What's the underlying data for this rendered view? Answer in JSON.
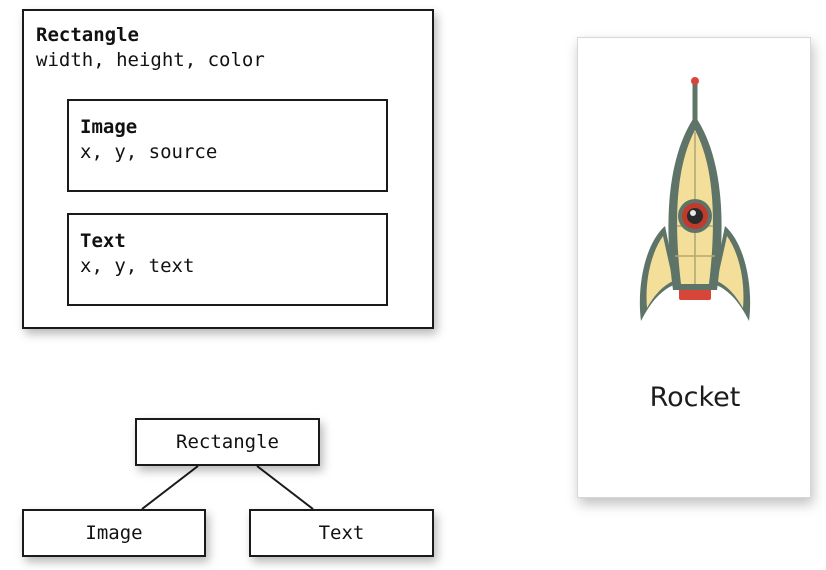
{
  "tree_box": {
    "title": "Rectangle",
    "props": "width, height, color",
    "children": [
      {
        "title": "Image",
        "props": "x, y, source"
      },
      {
        "title": "Text",
        "props": "x, y, text"
      }
    ]
  },
  "tree_diagram": {
    "root": "Rectangle",
    "children": [
      "Image",
      "Text"
    ]
  },
  "preview": {
    "label": "Rocket",
    "image_icon": "rocket-icon",
    "colors": {
      "body": "#f3df9a",
      "fin": "#5e7468",
      "outline": "#4a5e55",
      "window_ring": "#c23a2b",
      "exhaust": "#d8463a"
    }
  }
}
